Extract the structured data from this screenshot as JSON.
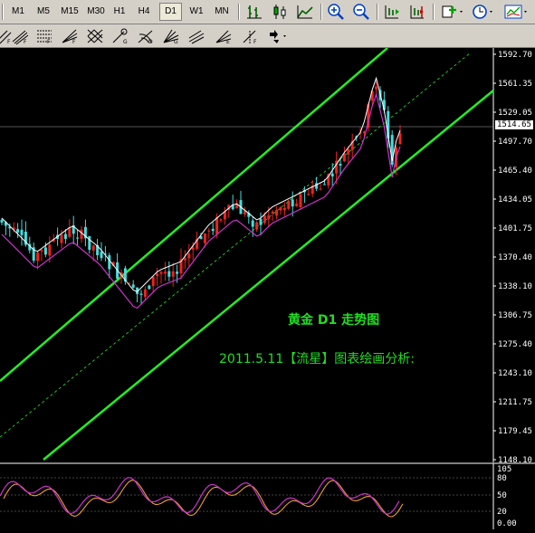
{
  "toolbar": {
    "timeframes": [
      "M1",
      "M5",
      "M15",
      "M30",
      "H1",
      "H4",
      "D1",
      "W1",
      "MN"
    ],
    "active_timeframe": "D1"
  },
  "chart": {
    "symbol_period": "黄金  D1  走势图",
    "note": "2011.5.11【流星】图表绘画分析:",
    "current_price": "1514.65",
    "price_labels": [
      "1592.70",
      "1561.35",
      "1529.05",
      "1497.70",
      "1465.40",
      "1434.05",
      "1401.75",
      "1370.40",
      "1338.10",
      "1306.75",
      "1275.40",
      "1243.10",
      "1211.75",
      "1179.45",
      "1148.10"
    ],
    "osc_labels": [
      "105",
      "80",
      "50",
      "20",
      "0.00"
    ],
    "colors": {
      "grid_axis": "#ffffff",
      "channel": "#22ee22",
      "annotation": "#22dd22",
      "up_candle": "#ee2222",
      "down_candle": "#44dddd",
      "ma_fast": "#ffffff",
      "ma_slow": "#cc33cc",
      "stoch_main": "#cc33cc",
      "stoch_signal": "#ffaa33"
    }
  }
}
